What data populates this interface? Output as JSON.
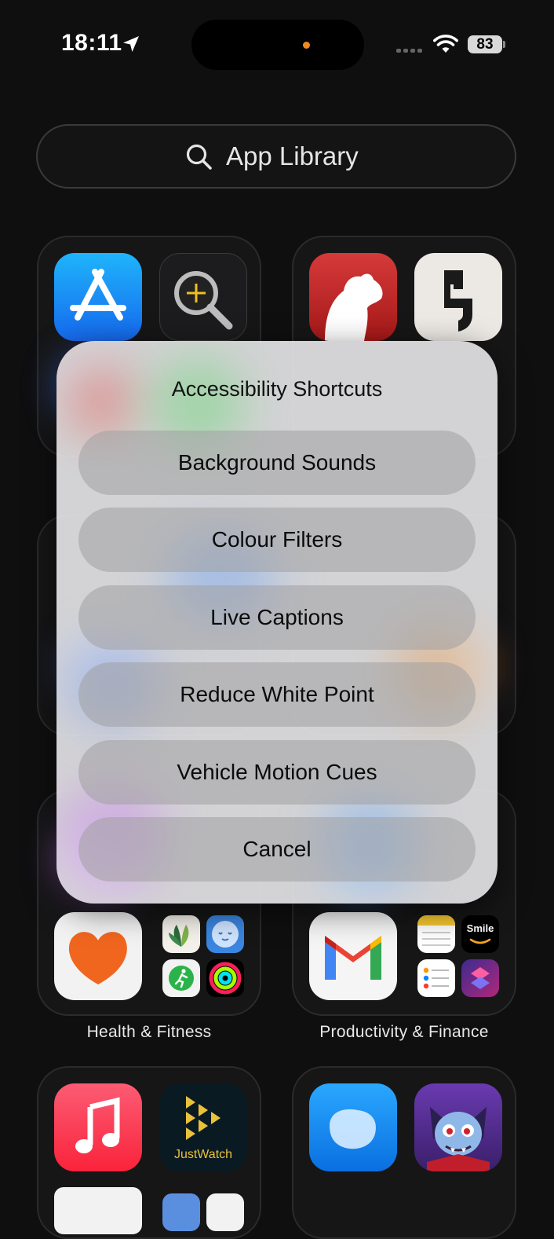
{
  "status_bar": {
    "time": "18:11",
    "battery": "83",
    "accent": "#f0891f"
  },
  "search": {
    "placeholder": "App Library",
    "icon": "search-icon"
  },
  "folders": {
    "health_label": "Health & Fitness",
    "productivity_label": "Productivity & Finance",
    "justwatch_text": "JustWatch",
    "smile_text": "Smile"
  },
  "dialog": {
    "title": "Accessibility Shortcuts",
    "options": [
      "Background Sounds",
      "Colour Filters",
      "Live Captions",
      "Reduce White Point",
      "Vehicle Motion Cues"
    ],
    "cancel": "Cancel"
  }
}
